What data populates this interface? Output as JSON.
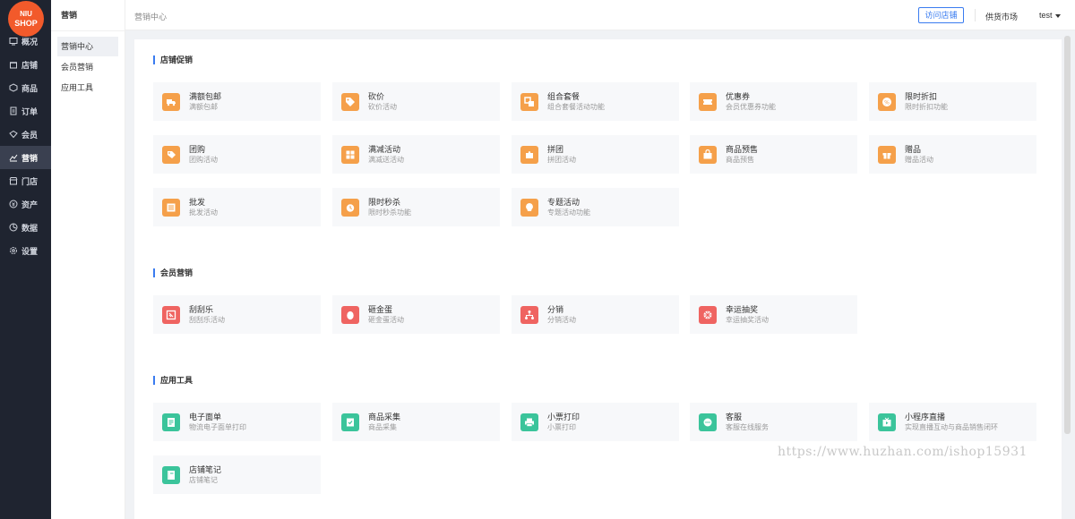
{
  "nav": {
    "logo_line1": "NIU",
    "logo_line2": "SHOP",
    "items": [
      {
        "label": "概况",
        "icon": "overview-icon"
      },
      {
        "label": "店铺",
        "icon": "store-icon"
      },
      {
        "label": "商品",
        "icon": "goods-icon"
      },
      {
        "label": "订单",
        "icon": "order-icon"
      },
      {
        "label": "会员",
        "icon": "member-icon"
      },
      {
        "label": "营销",
        "icon": "marketing-icon"
      },
      {
        "label": "门店",
        "icon": "shop-icon"
      },
      {
        "label": "资产",
        "icon": "asset-icon"
      },
      {
        "label": "数据",
        "icon": "data-icon"
      },
      {
        "label": "设置",
        "icon": "settings-icon"
      }
    ]
  },
  "sub": {
    "title": "营销",
    "items": [
      {
        "label": "营销中心"
      },
      {
        "label": "会员营销"
      },
      {
        "label": "应用工具"
      }
    ]
  },
  "header": {
    "breadcrumb": "营销中心",
    "visit_store": "访问店铺",
    "supply_market": "供货市场",
    "user": "test"
  },
  "sections": {
    "promo": {
      "title": "店铺促销",
      "cards": [
        {
          "title": "满额包邮",
          "desc": "满额包邮",
          "icon": "truck-icon"
        },
        {
          "title": "砍价",
          "desc": "砍价活动",
          "icon": "tag-cut-icon"
        },
        {
          "title": "组合套餐",
          "desc": "组合套餐活动功能",
          "icon": "combo-icon"
        },
        {
          "title": "优惠券",
          "desc": "会员优惠券功能",
          "icon": "coupon-icon"
        },
        {
          "title": "限时折扣",
          "desc": "限时折扣功能",
          "icon": "discount-icon"
        },
        {
          "title": "团购",
          "desc": "团购活动",
          "icon": "groupbuy-icon"
        },
        {
          "title": "满减活动",
          "desc": "满减送活动",
          "icon": "full-reduce-icon"
        },
        {
          "title": "拼团",
          "desc": "拼团活动",
          "icon": "puzzle-icon"
        },
        {
          "title": "商品预售",
          "desc": "商品预售",
          "icon": "presale-icon"
        },
        {
          "title": "赠品",
          "desc": "赠品活动",
          "icon": "gift-icon"
        },
        {
          "title": "批发",
          "desc": "批发活动",
          "icon": "wholesale-icon"
        },
        {
          "title": "限时秒杀",
          "desc": "限时秒杀功能",
          "icon": "alarm-icon"
        },
        {
          "title": "专题活动",
          "desc": "专题活动功能",
          "icon": "topic-icon"
        }
      ]
    },
    "member": {
      "title": "会员营销",
      "cards": [
        {
          "title": "刮刮乐",
          "desc": "刮刮乐活动",
          "icon": "scratch-icon"
        },
        {
          "title": "砸金蛋",
          "desc": "砸金蛋活动",
          "icon": "egg-icon"
        },
        {
          "title": "分销",
          "desc": "分销活动",
          "icon": "distribution-icon"
        },
        {
          "title": "幸运抽奖",
          "desc": "幸运抽奖活动",
          "icon": "lottery-icon"
        }
      ]
    },
    "tools": {
      "title": "应用工具",
      "cards": [
        {
          "title": "电子面单",
          "desc": "物流电子面单打印",
          "icon": "waybill-icon"
        },
        {
          "title": "商品采集",
          "desc": "商品采集",
          "icon": "collect-icon"
        },
        {
          "title": "小票打印",
          "desc": "小票打印",
          "icon": "printer-icon"
        },
        {
          "title": "客服",
          "desc": "客服在线服务",
          "icon": "chat-icon"
        },
        {
          "title": "小程序直播",
          "desc": "实现直播互动与商品销售闭环",
          "icon": "live-icon"
        },
        {
          "title": "店铺笔记",
          "desc": "店铺笔记",
          "icon": "notebook-icon"
        }
      ]
    }
  },
  "colors": {
    "promo": "#f5a04a",
    "member": "#ef6461",
    "tools": "#3bc49b",
    "accent": "#3a7cf0"
  },
  "watermark": "https://www.huzhan.com/ishop15931"
}
